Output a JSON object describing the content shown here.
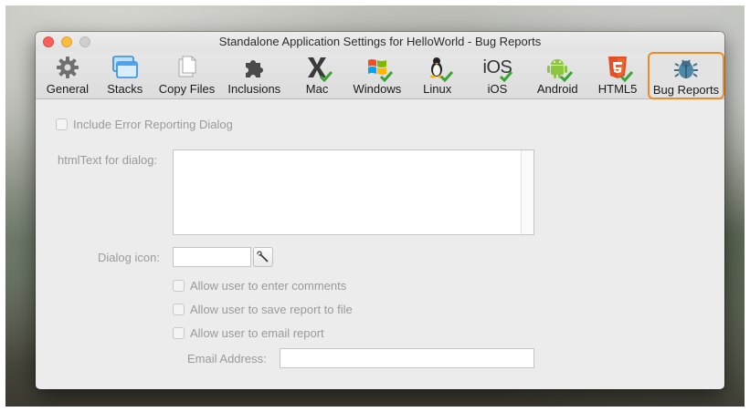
{
  "window": {
    "title": "Standalone Application Settings for HelloWorld - Bug Reports"
  },
  "toolbar": {
    "items": [
      {
        "label": "General",
        "icon": "gear-icon"
      },
      {
        "label": "Stacks",
        "icon": "stacks-icon"
      },
      {
        "label": "Copy Files",
        "icon": "copy-files-icon"
      },
      {
        "label": "Inclusions",
        "icon": "puzzle-icon"
      },
      {
        "label": "Mac",
        "icon": "mac-icon",
        "checked": true
      },
      {
        "label": "Windows",
        "icon": "windows-icon",
        "checked": true
      },
      {
        "label": "Linux",
        "icon": "linux-icon",
        "checked": true
      },
      {
        "label": "iOS",
        "icon": "ios-icon",
        "checked": true
      },
      {
        "label": "Android",
        "icon": "android-icon",
        "checked": true
      },
      {
        "label": "HTML5",
        "icon": "html5-icon",
        "checked": true
      },
      {
        "label": "Bug Reports",
        "icon": "bug-icon",
        "selected": true
      }
    ]
  },
  "form": {
    "include_error_label": "Include Error Reporting Dialog",
    "html_text_label": "htmlText for dialog:",
    "html_text_value": "",
    "dialog_icon_label": "Dialog icon:",
    "dialog_icon_value": "",
    "allow_comments_label": "Allow user to enter comments",
    "allow_save_label": "Allow user to save report to file",
    "allow_email_label": "Allow user to email report",
    "email_address_label": "Email Address:",
    "email_address_value": ""
  },
  "colors": {
    "selected_tab_border": "#f08a24",
    "check_green": "#3aa534"
  }
}
